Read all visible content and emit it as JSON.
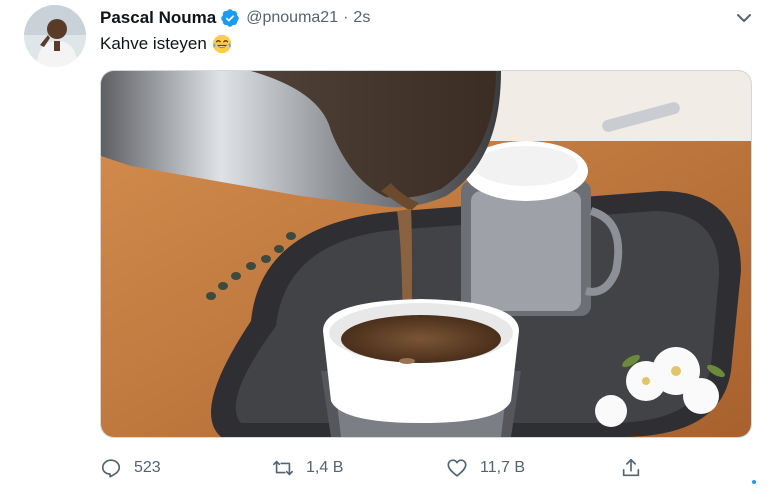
{
  "tweet": {
    "author": {
      "display_name": "Pascal Nouma",
      "handle": "@pnouma21",
      "verified": true,
      "avatar_icon": "profile-photo"
    },
    "separator": "·",
    "timestamp": "2s",
    "text": "Kahve isteyen",
    "emoji": "face-with-tears-of-joy",
    "media": {
      "description_icon": "turkish-coffee-pouring-photo"
    },
    "actions": {
      "reply": {
        "icon": "reply-icon",
        "count": "523"
      },
      "retweet": {
        "icon": "retweet-icon",
        "count": "1,4 B"
      },
      "like": {
        "icon": "heart-icon",
        "count": "11,7 B"
      },
      "share": {
        "icon": "share-icon"
      }
    }
  },
  "colors": {
    "text_primary": "#0f1419",
    "text_secondary": "#536471",
    "verified_blue": "#1d9bf0"
  }
}
